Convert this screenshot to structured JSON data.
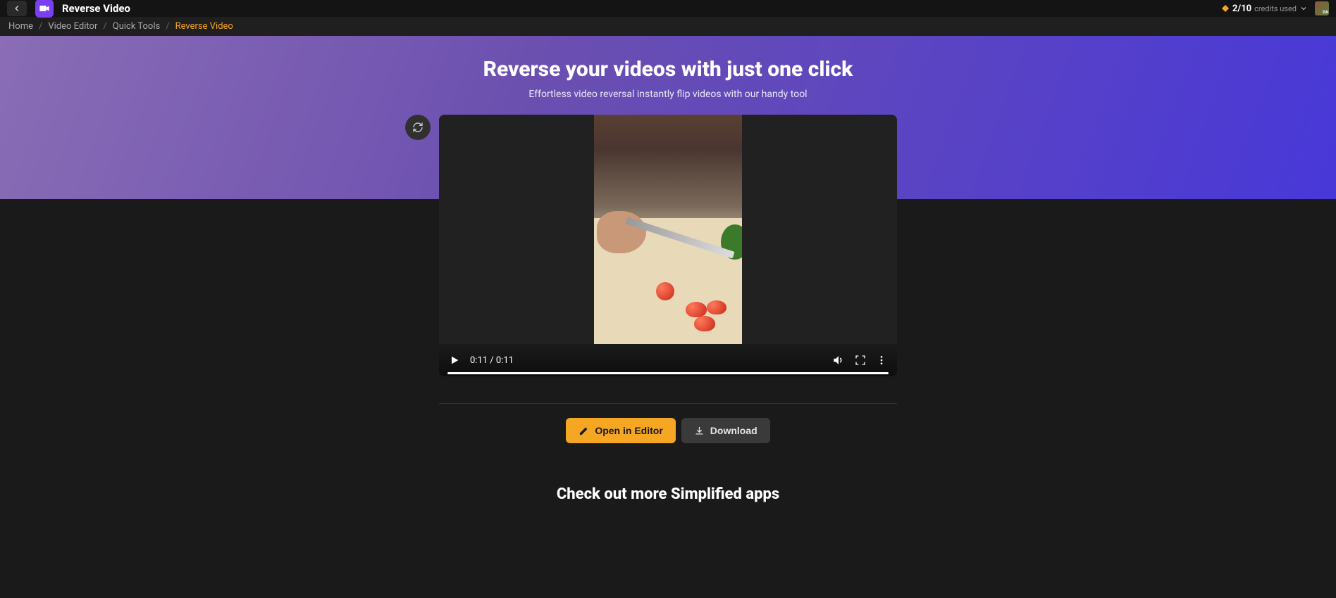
{
  "topbar": {
    "app_title": "Reverse Video",
    "credits_num": "2/10",
    "credits_label": "credits used",
    "avatar_initials": "DA"
  },
  "breadcrumb": {
    "items": [
      "Home",
      "Video Editor",
      "Quick Tools"
    ],
    "current": "Reverse Video"
  },
  "hero": {
    "title": "Reverse your videos with just one click",
    "subtitle": "Effortless video reversal instantly flip videos with our handy tool"
  },
  "video": {
    "time": "0:11 / 0:11"
  },
  "actions": {
    "open_label": "Open in Editor",
    "download_label": "Download"
  },
  "footer": {
    "heading": "Check out more Simplified apps"
  }
}
